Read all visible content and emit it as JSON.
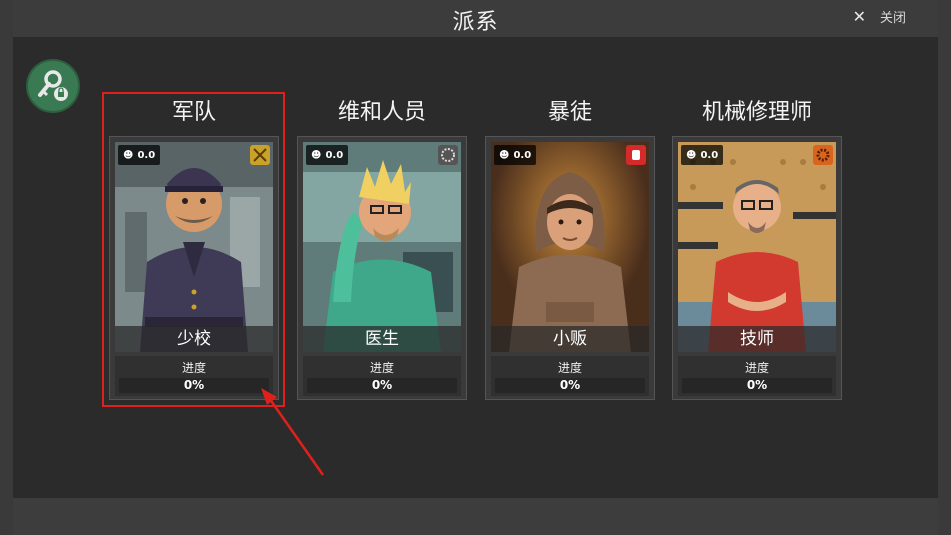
{
  "window": {
    "title": "派系",
    "close_label": "关闭"
  },
  "progress_label": "进度",
  "factions": [
    {
      "name": "军队",
      "role": "少校",
      "population": "0.0",
      "progress": "0%",
      "progress_value": 0,
      "icon": "crossed-swords-icon",
      "icon_color": "#c9a227"
    },
    {
      "name": "维和人员",
      "role": "医生",
      "population": "0.0",
      "progress": "0%",
      "progress_value": 0,
      "icon": "wreath-icon",
      "icon_color": "#555555"
    },
    {
      "name": "暴徒",
      "role": "小贩",
      "population": "0.0",
      "progress": "0%",
      "progress_value": 0,
      "icon": "raised-fist-icon",
      "icon_color": "#d42a2a"
    },
    {
      "name": "机械修理师",
      "role": "技师",
      "population": "0.0",
      "progress": "0%",
      "progress_value": 0,
      "icon": "gear-icon",
      "icon_color": "#d8641e"
    }
  ],
  "colors": {
    "accent_green": "#3a7a52",
    "highlight_red": "#e0201c"
  }
}
